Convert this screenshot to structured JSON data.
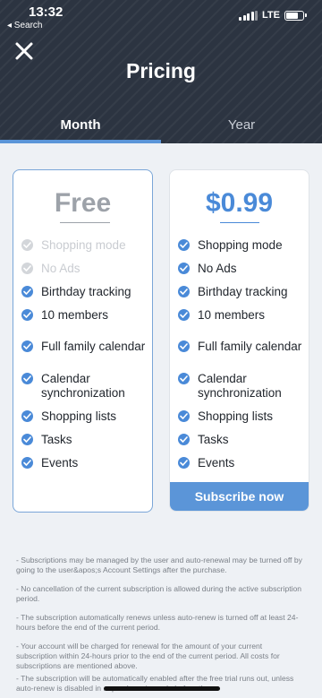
{
  "status": {
    "time": "13:32",
    "back": "◂ Search",
    "network": "LTE"
  },
  "header": {
    "title": "Pricing"
  },
  "tabs": [
    {
      "label": "Month"
    },
    {
      "label": "Year"
    }
  ],
  "plans": {
    "free": {
      "price": "Free",
      "features": [
        {
          "label": "Shopping mode",
          "enabled": false
        },
        {
          "label": "No Ads",
          "enabled": false
        },
        {
          "label": "Birthday tracking",
          "enabled": true
        },
        {
          "label": "10 members",
          "enabled": true
        },
        {
          "label": "Full family calendar",
          "enabled": true
        },
        {
          "label": "Calendar synchronization",
          "enabled": true
        },
        {
          "label": "Shopping lists",
          "enabled": true
        },
        {
          "label": "Tasks",
          "enabled": true
        },
        {
          "label": "Events",
          "enabled": true
        }
      ]
    },
    "paid": {
      "price": "$0.99",
      "button": "Subscribe now",
      "features": [
        {
          "label": "Shopping mode",
          "enabled": true
        },
        {
          "label": "No Ads",
          "enabled": true
        },
        {
          "label": "Birthday tracking",
          "enabled": true
        },
        {
          "label": "10 members",
          "enabled": true
        },
        {
          "label": "Full family calendar",
          "enabled": true
        },
        {
          "label": "Calendar synchronization",
          "enabled": true
        },
        {
          "label": "Shopping lists",
          "enabled": true
        },
        {
          "label": "Tasks",
          "enabled": true
        },
        {
          "label": "Events",
          "enabled": true
        }
      ]
    }
  },
  "terms": [
    "- Subscriptions may be managed by the user and auto-renewal may be turned off by going to the user&apos;s Account Settings after the purchase.",
    "- No cancellation of the current subscription is allowed during the active subscription period.",
    "- The subscription automatically renews unless auto-renew is turned off at least 24-hours before the end of the current period.",
    "- Your account will be charged for renewal for the amount of your current subscription within 24-hours prior to the end of the current period. All costs for subscriptions are mentioned above.",
    "- The subscription will be automatically enabled after the free trial runs out, unless auto-renew is disabled in ... purchase is made before the"
  ],
  "colors": {
    "accent": "#5b95d8",
    "header_bg": "#2c3441",
    "price_blue": "#4a8ad8",
    "disabled": "#c9ccd1"
  },
  "icons": {
    "close": "close-icon",
    "check": "check-circle-icon"
  }
}
